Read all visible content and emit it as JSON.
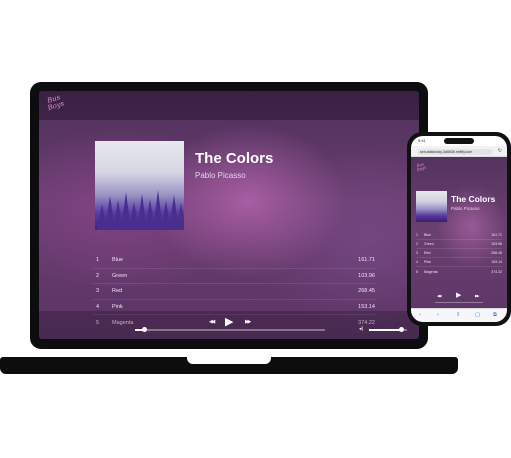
{
  "logo": {
    "text": "Bus Boys"
  },
  "player": {
    "title": "The Colors",
    "artist": "Pablo Picasso",
    "tracks": [
      {
        "num": "1",
        "name": "Blue",
        "duration": "161.71"
      },
      {
        "num": "2",
        "name": "Green",
        "duration": "103.96"
      },
      {
        "num": "3",
        "name": "Red",
        "duration": "268.45"
      },
      {
        "num": "4",
        "name": "Pink",
        "duration": "153.14"
      },
      {
        "num": "5",
        "name": "Magenta",
        "duration": "374.22"
      }
    ],
    "controls": {
      "prev_icon": "◀◀",
      "play_icon": "▶",
      "next_icon": "▶▶"
    },
    "progress_fraction": 0.05,
    "volume_fraction": 0.85
  },
  "phone": {
    "status_time": "9:41",
    "url": "sen-stationary-3a563b.netlify.com",
    "toolbar": {
      "back": "‹",
      "forward": "›",
      "share": "⇪",
      "bookmarks": "▢",
      "tabs": "⧉"
    }
  },
  "colors": {
    "accent_pink": "#e48ec9",
    "bg_purple": "#6a3f70",
    "safari_blue": "#2f73e0"
  }
}
